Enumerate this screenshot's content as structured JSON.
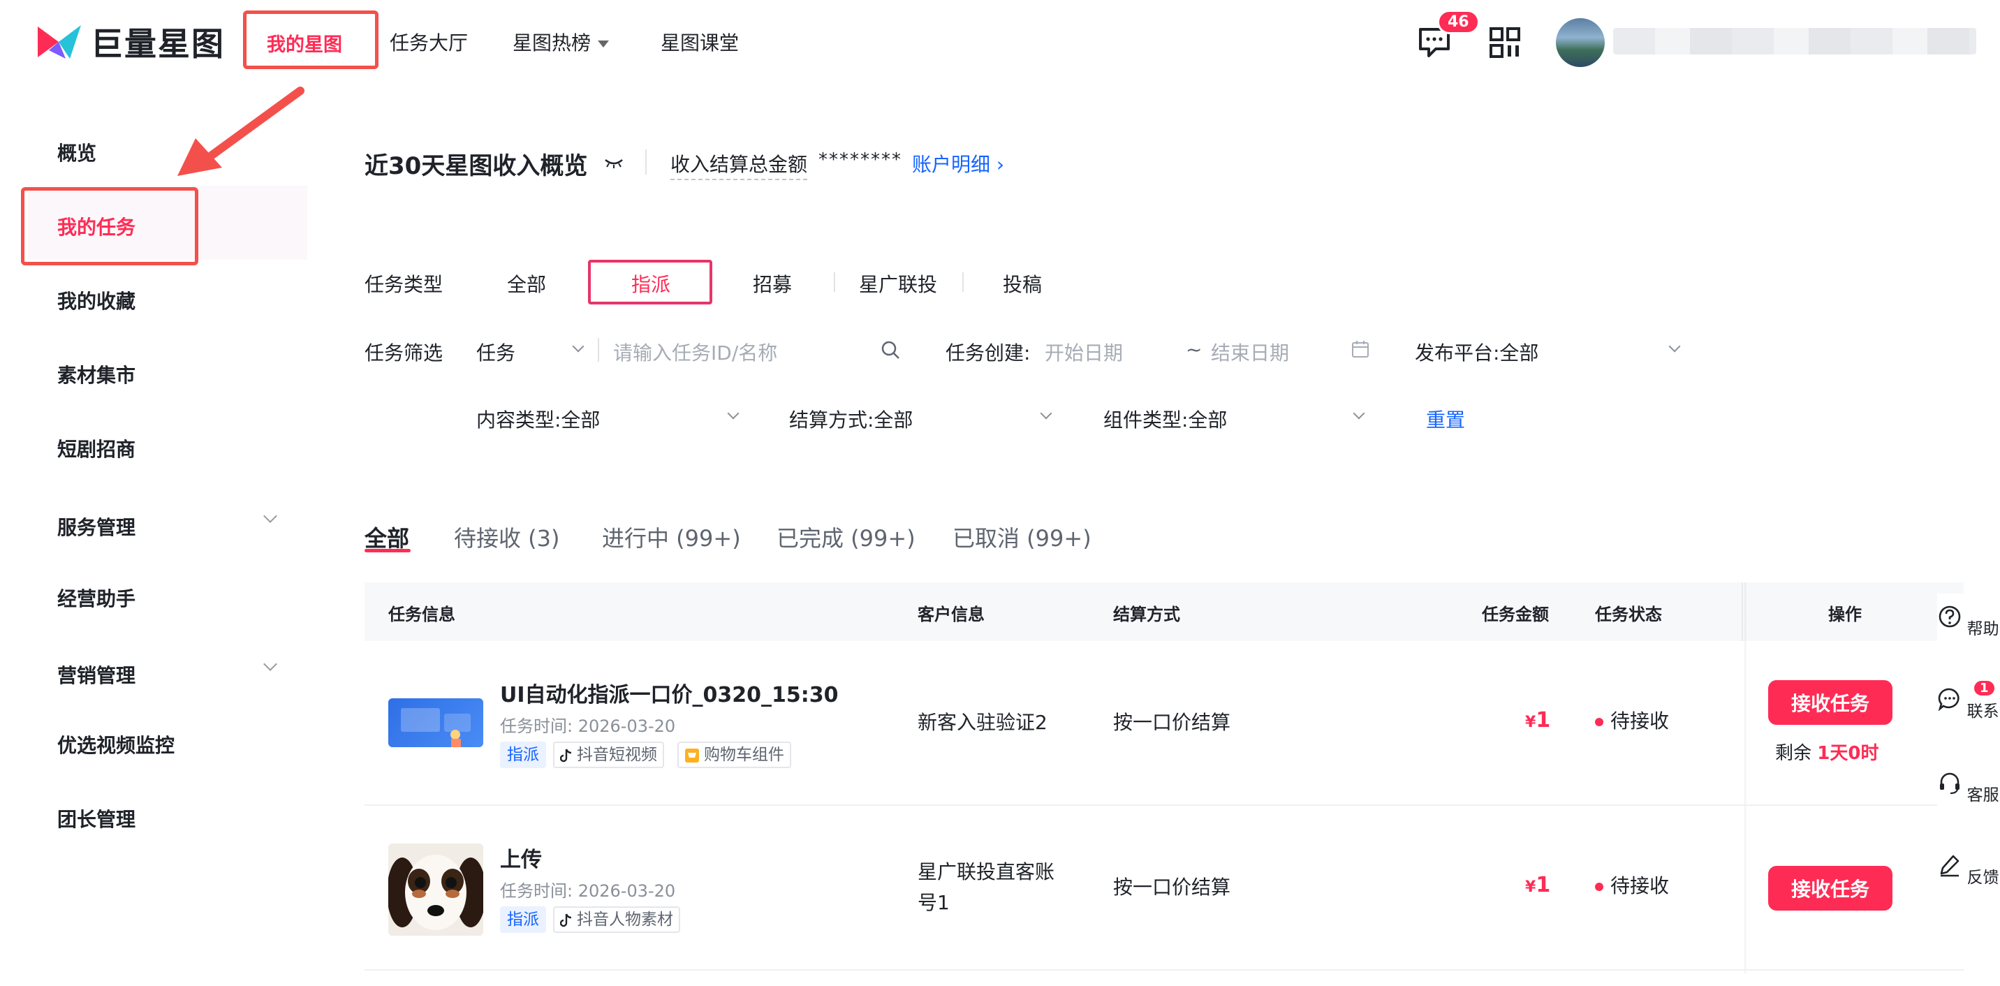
{
  "header": {
    "logo_text": "巨量星图",
    "nav": [
      "我的星图",
      "任务大厅",
      "星图热榜",
      "星图课堂"
    ],
    "message_badge": "46"
  },
  "sidebar": {
    "items": [
      "概览",
      "我的任务",
      "我的收藏",
      "素材集市",
      "短剧招商",
      "服务管理",
      "经营助手",
      "营销管理",
      "优选视频监控",
      "团长管理"
    ]
  },
  "overview": {
    "title": "近30天星图收入概览",
    "income_label": "收入结算总金额",
    "income_value": "********",
    "account_link": "账户明细 ›"
  },
  "filters": {
    "type_label": "任务类型",
    "types": [
      "全部",
      "指派",
      "招募",
      "星广联投",
      "投稿"
    ],
    "filter_label": "任务筛选",
    "task_select": "任务",
    "search_placeholder": "请输入任务ID/名称",
    "created_label": "任务创建:",
    "start_placeholder": "开始日期",
    "range_sep": "~",
    "end_placeholder": "结束日期",
    "platform": "发布平台:全部",
    "content_type": "内容类型:全部",
    "settle_type": "结算方式:全部",
    "component_type": "组件类型:全部",
    "reset": "重置"
  },
  "status_tabs": [
    "全部",
    "待接收 (3)",
    "进行中 (99+)",
    "已完成 (99+)",
    "已取消 (99+)"
  ],
  "table": {
    "headers": [
      "任务信息",
      "客户信息",
      "结算方式",
      "任务金额",
      "任务状态",
      "操作"
    ],
    "rows": [
      {
        "name": "UI自动化指派一口价_0320_15:30",
        "time": "任务时间: 2026-03-20",
        "tags": [
          "指派",
          "抖音短视频",
          "购物车组件"
        ],
        "customer": "新客入驻验证2",
        "settle": "按一口价结算",
        "amount_symbol": "¥",
        "amount": "1",
        "status": "待接收",
        "action": "接收任务",
        "remain_label": "剩余",
        "remain_value": "1天0时"
      },
      {
        "name": "上传",
        "time": "任务时间: 2026-03-20",
        "tags": [
          "指派",
          "抖音人物素材"
        ],
        "customer_line1": "星广联投直客账",
        "customer_line2": "号1",
        "settle": "按一口价结算",
        "amount_symbol": "¥",
        "amount": "1",
        "status": "待接收",
        "action": "接收任务"
      }
    ]
  },
  "float_bar": {
    "items": [
      "帮助",
      "联系",
      "客服",
      "反馈"
    ],
    "contact_badge": "1"
  }
}
